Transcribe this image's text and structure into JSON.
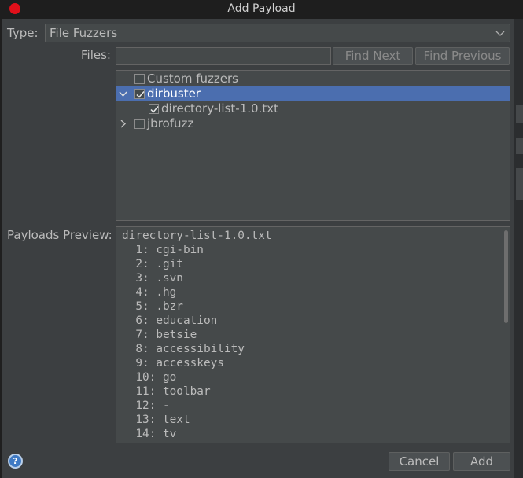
{
  "window": {
    "title": "Add Payload"
  },
  "type_field": {
    "label": "Type:",
    "value": "File Fuzzers"
  },
  "files_field": {
    "label": "Files:",
    "value": "",
    "find_next": "Find Next",
    "find_previous": "Find Previous"
  },
  "tree": {
    "items": [
      {
        "label": "Custom fuzzers",
        "checked": false,
        "expander": "none",
        "selected": false
      },
      {
        "label": "dirbuster",
        "checked": true,
        "expander": "expanded",
        "selected": true
      },
      {
        "label": "directory-list-1.0.txt",
        "checked": true,
        "expander": "none",
        "selected": false
      },
      {
        "label": "jbrofuzz",
        "checked": false,
        "expander": "collapsed",
        "selected": false
      }
    ]
  },
  "preview": {
    "label": "Payloads Preview:",
    "header": "directory-list-1.0.txt",
    "lines": [
      "  1: cgi-bin",
      "  2: .git",
      "  3: .svn",
      "  4: .hg",
      "  5: .bzr",
      "  6: education",
      "  7: betsie",
      "  8: accessibility",
      "  9: accesskeys",
      "  10: go",
      "  11: toolbar",
      "  12: -",
      "  13: text",
      "  14: tv"
    ]
  },
  "buttons": {
    "help": "?",
    "cancel": "Cancel",
    "add": "Add"
  },
  "colors": {
    "dialog_bg": "#3c3f41",
    "selection": "#4b6eaf",
    "close": "#e0101a"
  }
}
